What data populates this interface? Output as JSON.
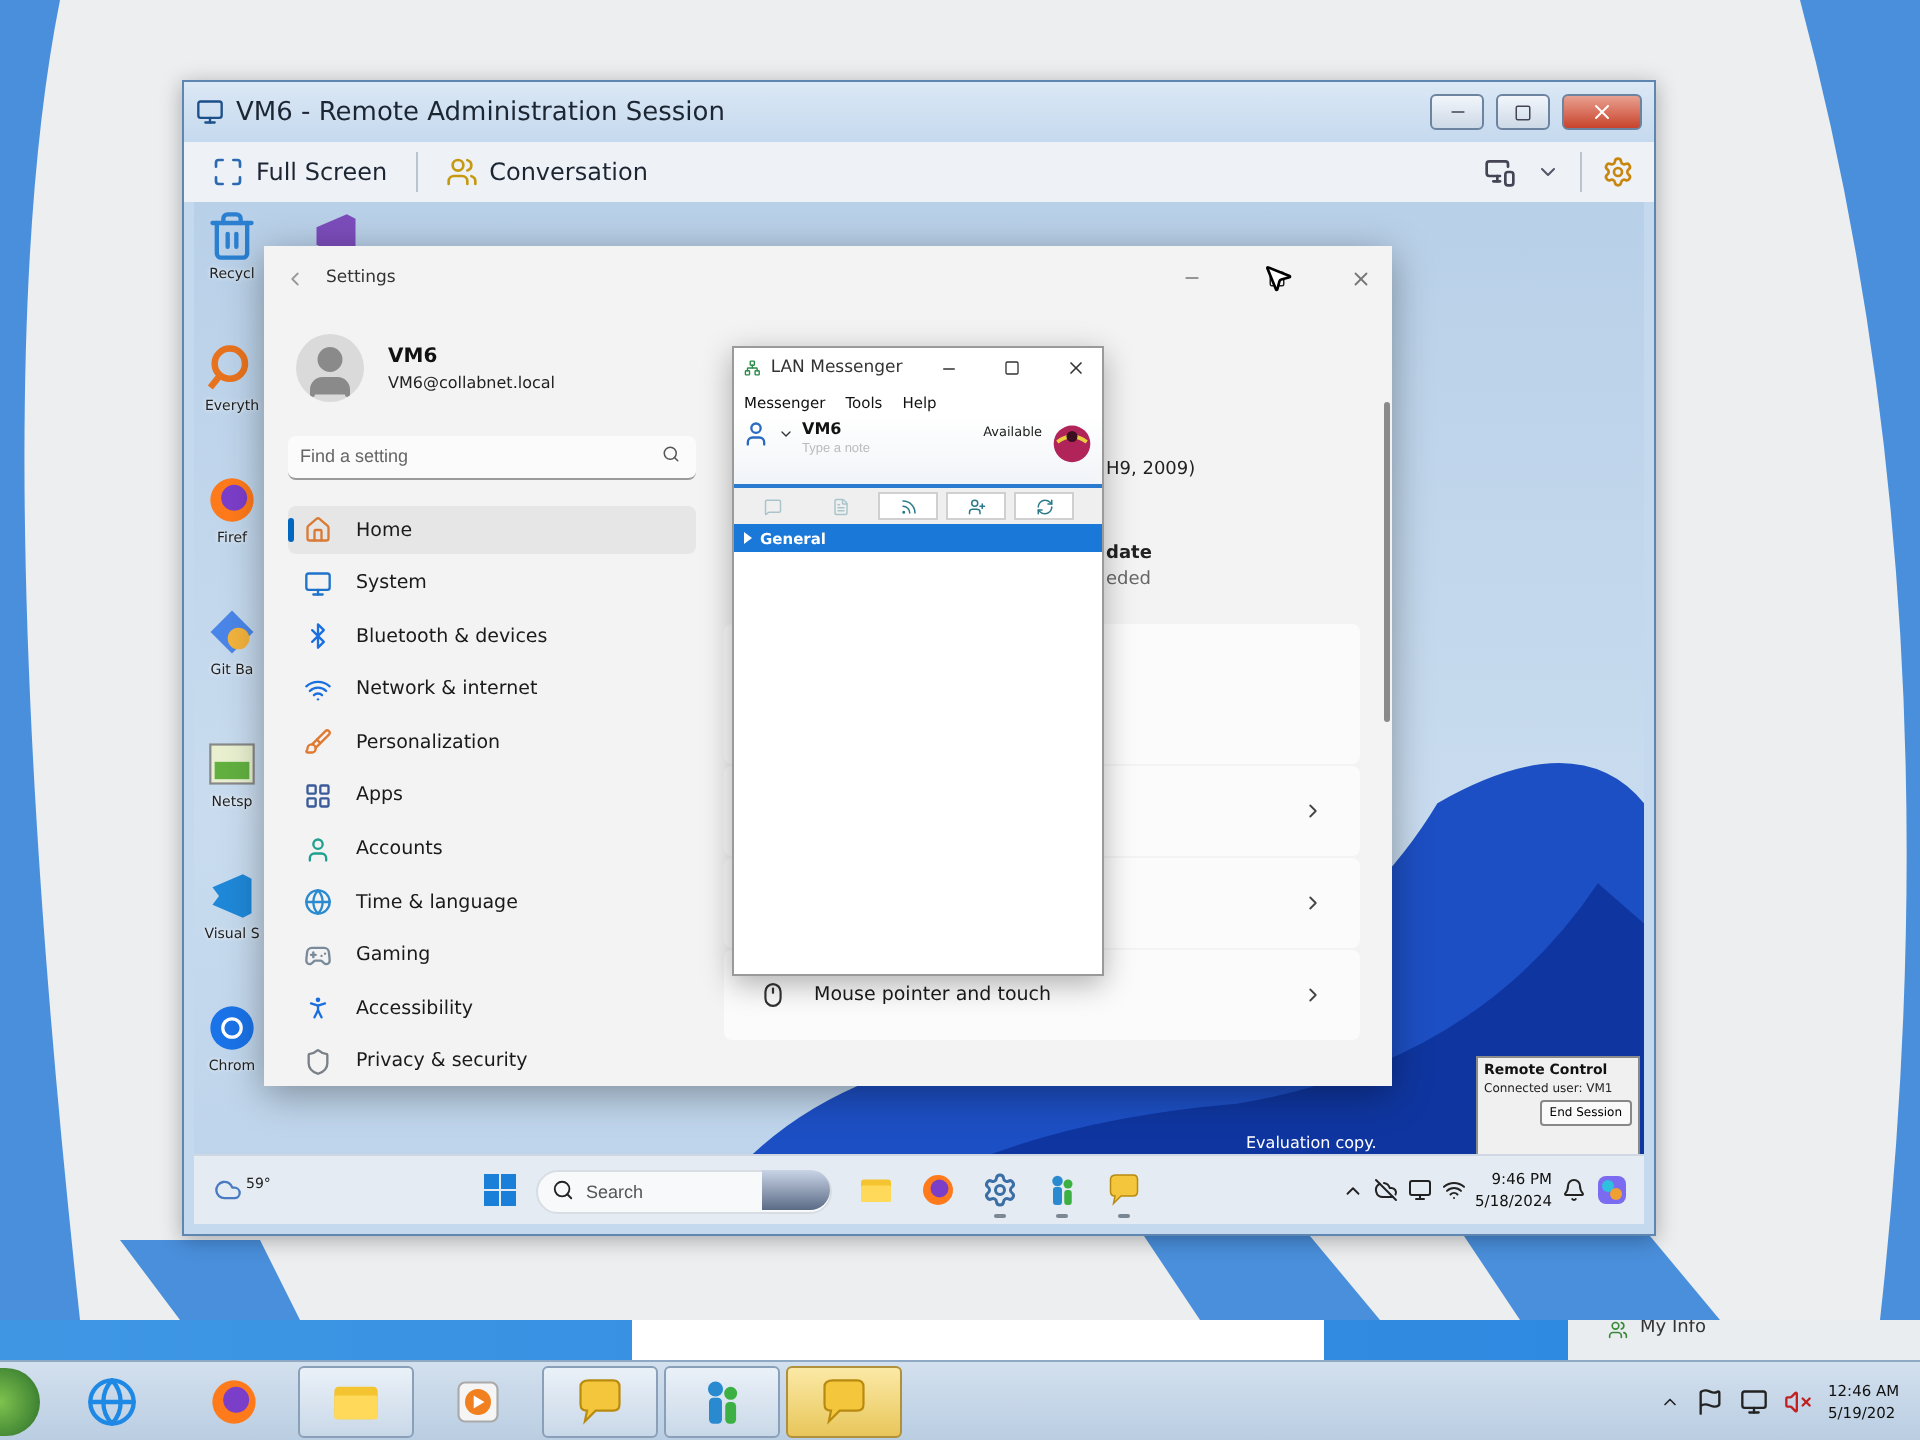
{
  "session_window": {
    "title": "VM6 - Remote Administration Session",
    "toolbar": [
      {
        "kind": "fullscreen",
        "label": "Full Screen"
      },
      {
        "kind": "conversation",
        "label": "Conversation"
      }
    ]
  },
  "remote_desktop": {
    "desktop_icons": [
      {
        "kind": "recycle",
        "label": "Recycl"
      },
      {
        "kind": "search",
        "label": "Everyth"
      },
      {
        "kind": "firefox",
        "label": "Firef"
      },
      {
        "kind": "git",
        "label": "Git Ba"
      },
      {
        "kind": "netsp",
        "label": "Netsp"
      },
      {
        "kind": "vscode",
        "label": "Visual S"
      },
      {
        "kind": "chrome",
        "label": "Chrom"
      }
    ],
    "settings": {
      "title": "Settings",
      "user": {
        "name": "VM6",
        "email": "VM6@collabnet.local"
      },
      "search": {
        "placeholder": "Find a setting"
      },
      "nav": [
        {
          "kind": "home",
          "label": "Home",
          "selected": true
        },
        {
          "kind": "system",
          "label": "System",
          "selected": false
        },
        {
          "kind": "bluetooth",
          "label": "Bluetooth & devices",
          "selected": false
        },
        {
          "kind": "network",
          "label": "Network & internet",
          "selected": false
        },
        {
          "kind": "personalization",
          "label": "Personalization",
          "selected": false
        },
        {
          "kind": "apps",
          "label": "Apps",
          "selected": false
        },
        {
          "kind": "accounts",
          "label": "Accounts",
          "selected": false
        },
        {
          "kind": "time",
          "label": "Time & language",
          "selected": false
        },
        {
          "kind": "gaming",
          "label": "Gaming",
          "selected": false
        },
        {
          "kind": "accessibility",
          "label": "Accessibility",
          "selected": false
        },
        {
          "kind": "privacy",
          "label": "Privacy & security",
          "selected": false
        }
      ],
      "info": [
        {
          "kind": "plain",
          "text": "H9, 2009)"
        },
        {
          "kind": "bold",
          "text": "date"
        },
        {
          "kind": "muted",
          "text": "eded"
        }
      ],
      "rows": [
        {
          "kind": "blank"
        },
        {
          "kind": "link"
        },
        {
          "kind": "link"
        },
        {
          "kind": "mouse",
          "label": "Mouse pointer and touch"
        }
      ]
    },
    "messenger": {
      "title": "LAN Messenger",
      "menu": [
        "Messenger",
        "Tools",
        "Help"
      ],
      "user": "VM6",
      "status": "Available",
      "note": {
        "placeholder": "Type a note"
      },
      "toolbar": [
        {
          "kind": "chat",
          "disabled": true
        },
        {
          "kind": "file",
          "disabled": true
        },
        {
          "kind": "broadcast",
          "disabled": false
        },
        {
          "kind": "add",
          "disabled": false
        },
        {
          "kind": "refresh",
          "disabled": false
        }
      ],
      "groups": [
        {
          "label": "General",
          "selected": true,
          "expanded": false
        }
      ]
    },
    "watermark": "Evaluation copy.",
    "remote_control": {
      "title": "Remote Control",
      "status": "Connected user: VM1",
      "button": "End Session"
    },
    "taskbar": {
      "weather": "59°",
      "search": {
        "placeholder": "Search"
      },
      "apps": [
        {
          "kind": "explorer",
          "running": false
        },
        {
          "kind": "firefox",
          "running": false
        },
        {
          "kind": "settings",
          "running": true
        },
        {
          "kind": "messenger",
          "running": true
        },
        {
          "kind": "chat",
          "running": true
        }
      ],
      "time": "9:46 PM",
      "date": "5/18/2024"
    }
  },
  "host_strip": {
    "label": "My Info"
  },
  "host_taskbar": {
    "apps": [
      {
        "kind": "ie",
        "running": false,
        "selected": false
      },
      {
        "kind": "firefox",
        "running": false,
        "selected": false
      },
      {
        "kind": "explorer",
        "running": true,
        "selected": false
      },
      {
        "kind": "media",
        "running": false,
        "selected": false
      },
      {
        "kind": "chat",
        "running": true,
        "selected": false
      },
      {
        "kind": "messenger",
        "running": true,
        "selected": false
      },
      {
        "kind": "lan",
        "running": true,
        "selected": true
      }
    ],
    "time": "12:46 AM",
    "date": "5/19/202"
  }
}
